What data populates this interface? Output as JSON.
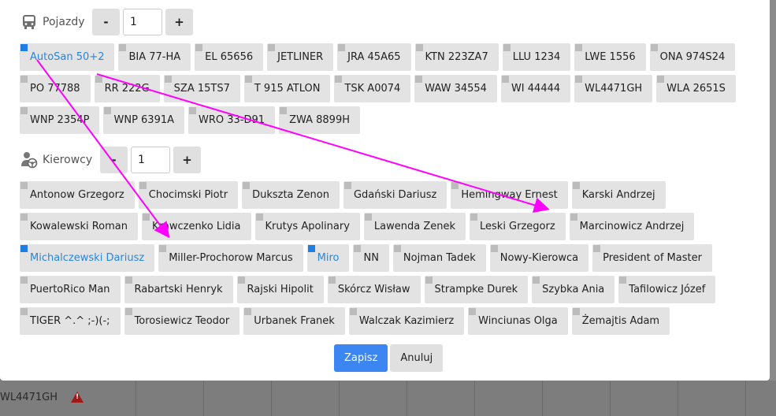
{
  "vehicles": {
    "label": "Pojazdy",
    "icon": "bus-icon",
    "count": "1",
    "decrement": "-",
    "increment": "+",
    "items": [
      {
        "label": "AutoSan 50+2",
        "selected": true
      },
      {
        "label": "BIA 77-HA"
      },
      {
        "label": "EL 65656"
      },
      {
        "label": "JETLINER"
      },
      {
        "label": "JRA 45A65"
      },
      {
        "label": "KTN 223ZA7"
      },
      {
        "label": "LLU 1234"
      },
      {
        "label": "LWE 1556"
      },
      {
        "label": "ONA 974S24"
      },
      {
        "label": "PO 77788"
      },
      {
        "label": "RR 222G"
      },
      {
        "label": "SZA 15TS7"
      },
      {
        "label": "T 915 ATLON"
      },
      {
        "label": "TSK A0074"
      },
      {
        "label": "WAW 34554"
      },
      {
        "label": "WI 44444"
      },
      {
        "label": "WL4471GH"
      },
      {
        "label": "WLA 2651S"
      },
      {
        "label": "WNP 2354P"
      },
      {
        "label": "WNP 6391A"
      },
      {
        "label": "WRO 33-D91"
      },
      {
        "label": "ZWA 8899H"
      }
    ]
  },
  "drivers": {
    "label": "Kierowcy",
    "icon": "driver-icon",
    "count": "1",
    "decrement": "-",
    "increment": "+",
    "items": [
      {
        "label": "Antonow Grzegorz"
      },
      {
        "label": "Chocimski Piotr"
      },
      {
        "label": "Dukszta Zenon"
      },
      {
        "label": "Gdański Dariusz"
      },
      {
        "label": "Hemingway Ernest"
      },
      {
        "label": "Karski Andrzej"
      },
      {
        "label": "Kowalewski Roman"
      },
      {
        "label": "Krawczenko Lidia"
      },
      {
        "label": "Krutys Apolinary"
      },
      {
        "label": "Lawenda Zenek"
      },
      {
        "label": "Leski Grzegorz"
      },
      {
        "label": "Marcinowicz Andrzej"
      },
      {
        "label": "Michalczewski Dariusz",
        "selected": true
      },
      {
        "label": "Miller-Prochorow Marcus"
      },
      {
        "label": "Miro",
        "selected": true
      },
      {
        "label": "NN"
      },
      {
        "label": "Nojman Tadek"
      },
      {
        "label": "Nowy-Kierowca"
      },
      {
        "label": "President of Master"
      },
      {
        "label": "PuertoRico Man"
      },
      {
        "label": "Rabartski Henryk"
      },
      {
        "label": "Rajski Hipolit"
      },
      {
        "label": "Skórcz Wisław"
      },
      {
        "label": "Strampke Durek"
      },
      {
        "label": "Szybka Ania"
      },
      {
        "label": "Tafilowicz Józef"
      },
      {
        "label": "TIGER ^.^ ;-)(-;"
      },
      {
        "label": "Torosiewicz Teodor"
      },
      {
        "label": "Urbanek Franek"
      },
      {
        "label": "Walczak Kazimierz"
      },
      {
        "label": "Winciunas Olga"
      },
      {
        "label": "Żemajtis Adam"
      }
    ]
  },
  "actions": {
    "save": "Zapisz",
    "cancel": "Anuluj"
  },
  "background": {
    "row_text": "WL4471GH",
    "warning_icon": "warning-icon"
  },
  "colors": {
    "selected_text": "#2a86d9",
    "selected_marker": "#1f7fe0",
    "primary": "#3b86f0",
    "annotation_arrow": "#ff00ff"
  }
}
